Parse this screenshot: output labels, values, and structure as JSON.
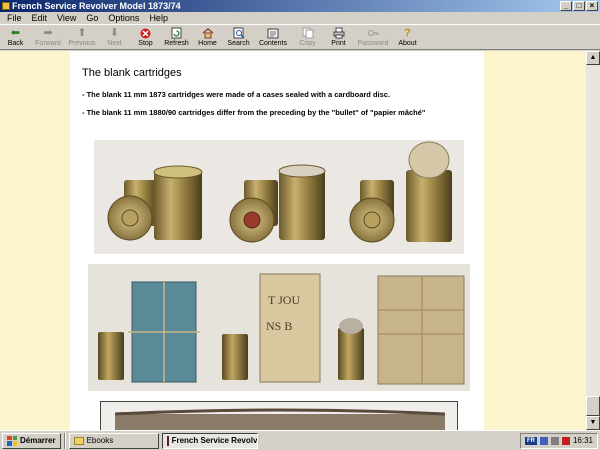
{
  "window": {
    "title": "French Service Revolver Model 1873/74",
    "buttons": [
      "_",
      "□",
      "×"
    ]
  },
  "menu": [
    "File",
    "Edit",
    "View",
    "Go",
    "Options",
    "Help"
  ],
  "toolbar": {
    "back": "Back",
    "forward": "Forward",
    "previous": "Previous",
    "next": "Next",
    "stop": "Stop",
    "refresh": "Refresh",
    "home": "Home",
    "search": "Search",
    "contents": "Contents",
    "copy": "Copy",
    "print": "Print",
    "password": "Password",
    "about": "About"
  },
  "page": {
    "heading": "The blank cartridges",
    "para1": "- The blank 11 mm 1873 cartridges were made of a cases sealed with a cardboard disc.",
    "para2": "- The blank 11 mm 1880/90 cartridges differ from the preceding by the \"bullet\" of \"papier mâché\""
  },
  "taskbar": {
    "start": "Démarrer",
    "tasks": [
      "Ebooks",
      "French Service Revolv..."
    ],
    "lang": "FR",
    "clock": "16:31"
  },
  "colors": {
    "titlebar_start": "#0a246a",
    "content_bg": "#fcf4cc",
    "stop_red": "#d02020"
  }
}
